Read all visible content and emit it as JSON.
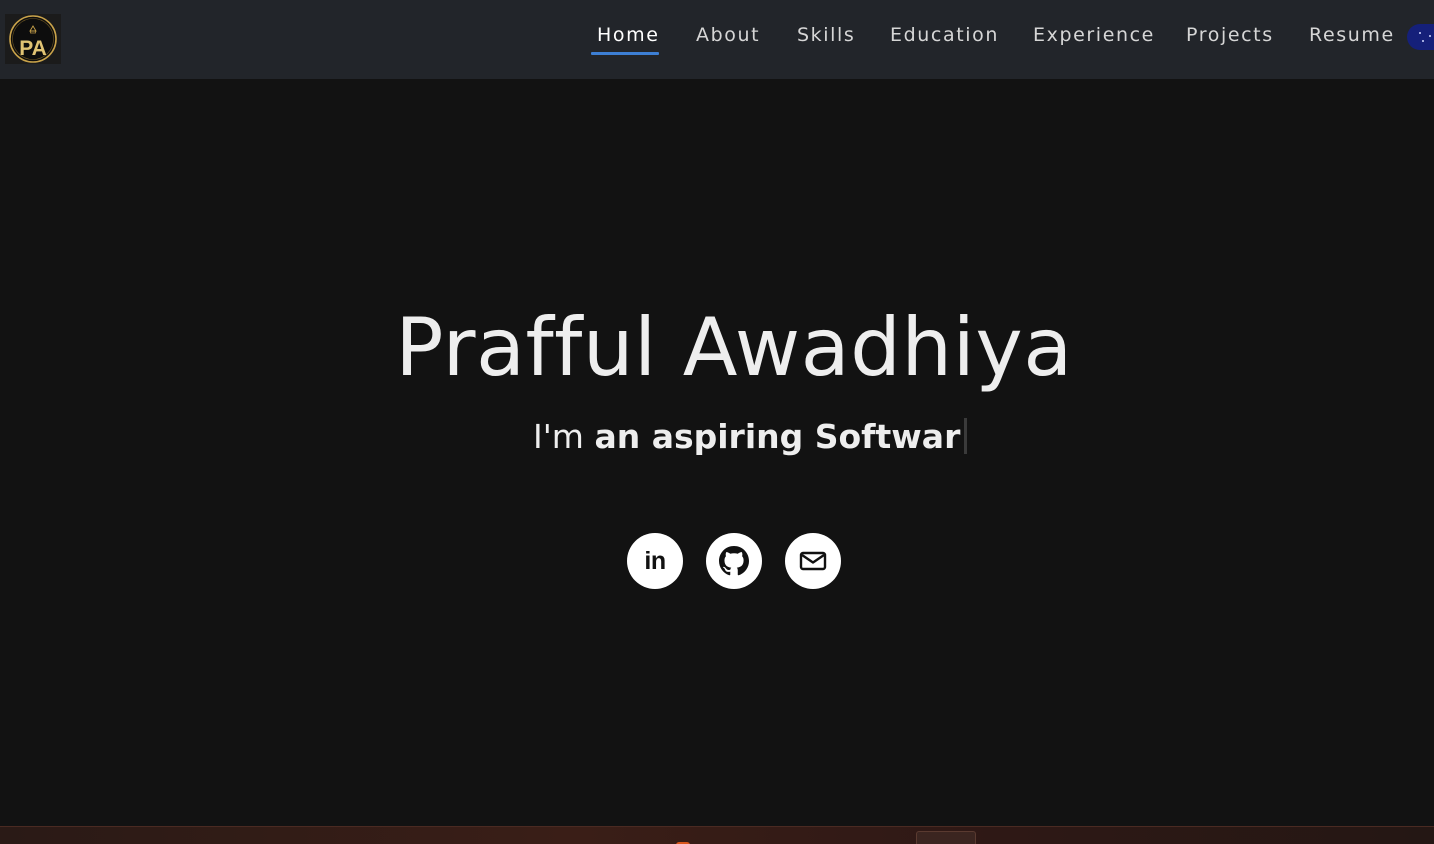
{
  "navbar": {
    "logo": {
      "text": "PA",
      "icon": "pa-monogram-logo",
      "accent": "#c8a24a"
    },
    "links": [
      {
        "label": "Home",
        "active": true
      },
      {
        "label": "About",
        "active": false
      },
      {
        "label": "Skills",
        "active": false
      },
      {
        "label": "Education",
        "active": false
      },
      {
        "label": "Experience",
        "active": false
      },
      {
        "label": "Projects",
        "active": false
      },
      {
        "label": "Resume",
        "active": false
      }
    ],
    "underline_color": "#3d7fd4",
    "theme_toggle": {
      "icon": "night-mode-toggle-icon",
      "color": "#15207a"
    }
  },
  "hero": {
    "name": "Prafful Awadhiya",
    "tagline_prefix": "I'm ",
    "tagline_typed": "an aspiring Softwar"
  },
  "social": [
    {
      "name": "LinkedIn",
      "icon": "linkedin-icon",
      "text": "in"
    },
    {
      "name": "GitHub",
      "icon": "github-icon"
    },
    {
      "name": "Email",
      "icon": "mail-icon"
    }
  ],
  "colors": {
    "background": "#121212",
    "navbar": "#22252a",
    "text": "#eeeeee"
  }
}
